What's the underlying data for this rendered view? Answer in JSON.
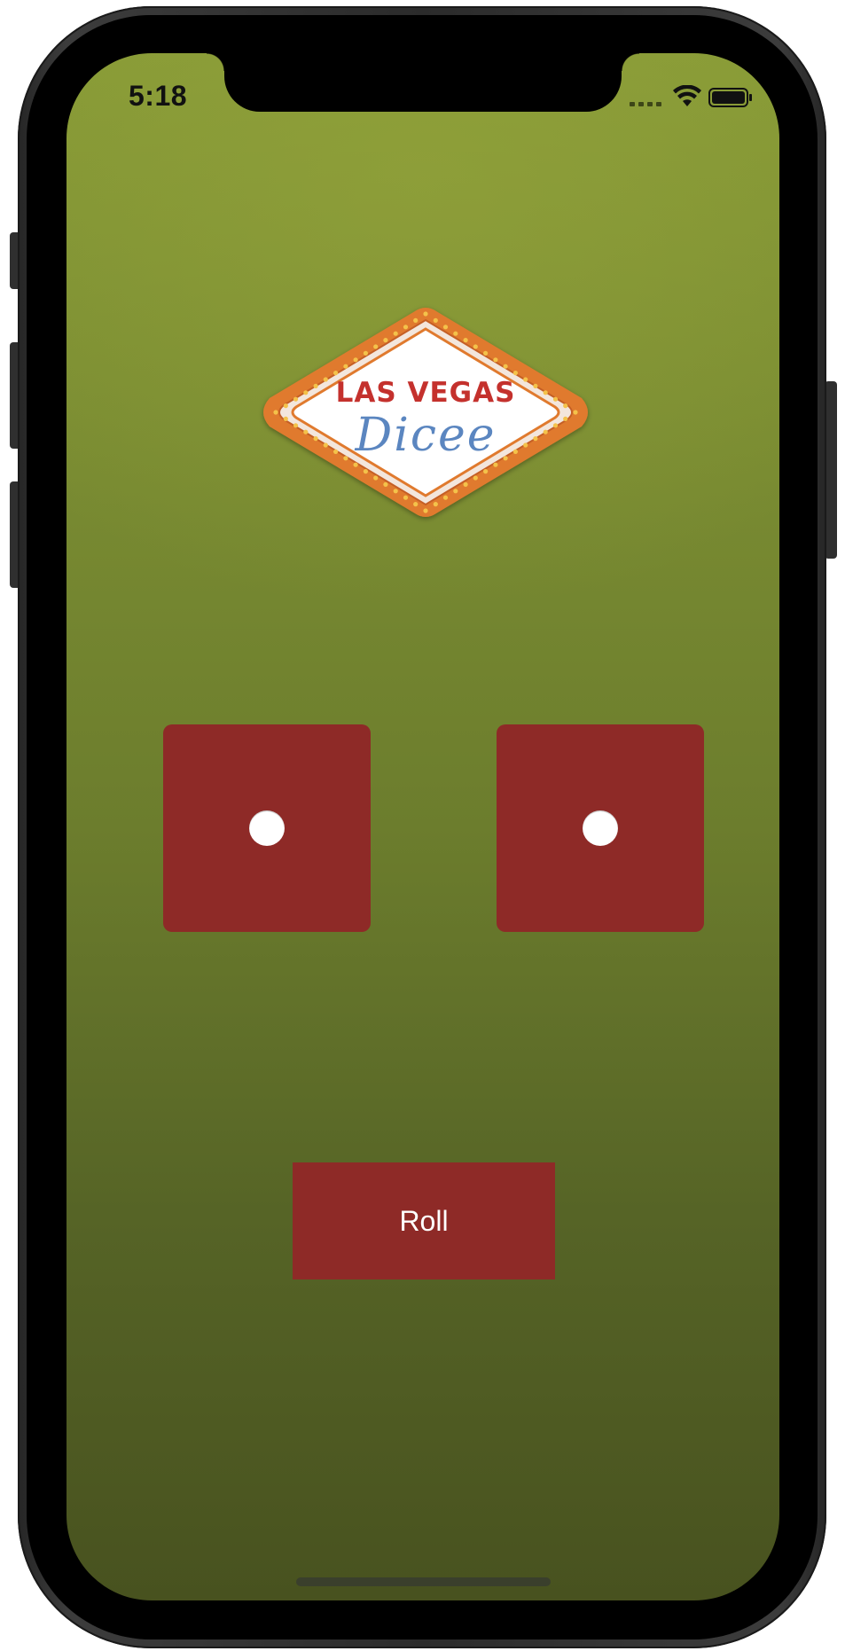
{
  "status_bar": {
    "time": "5:18",
    "icons": [
      "cellular-signal-icon",
      "wifi-icon",
      "battery-icon"
    ]
  },
  "logo": {
    "line1": "LAS VEGAS",
    "line2": "Dicee",
    "colors": {
      "line1": "#c4312d",
      "line2": "#5b86c0",
      "border": "#e07a2e",
      "bulbs": "#f4c24a"
    }
  },
  "dice": [
    {
      "name": "left-die",
      "value": 1
    },
    {
      "name": "right-die",
      "value": 1
    }
  ],
  "roll_button": {
    "label": "Roll"
  },
  "colors": {
    "felt_top": "#879a36",
    "felt_bottom": "#48521f",
    "die_color": "#8e2a27",
    "pip_color": "#ffffff",
    "button_color": "#8e2a27"
  }
}
